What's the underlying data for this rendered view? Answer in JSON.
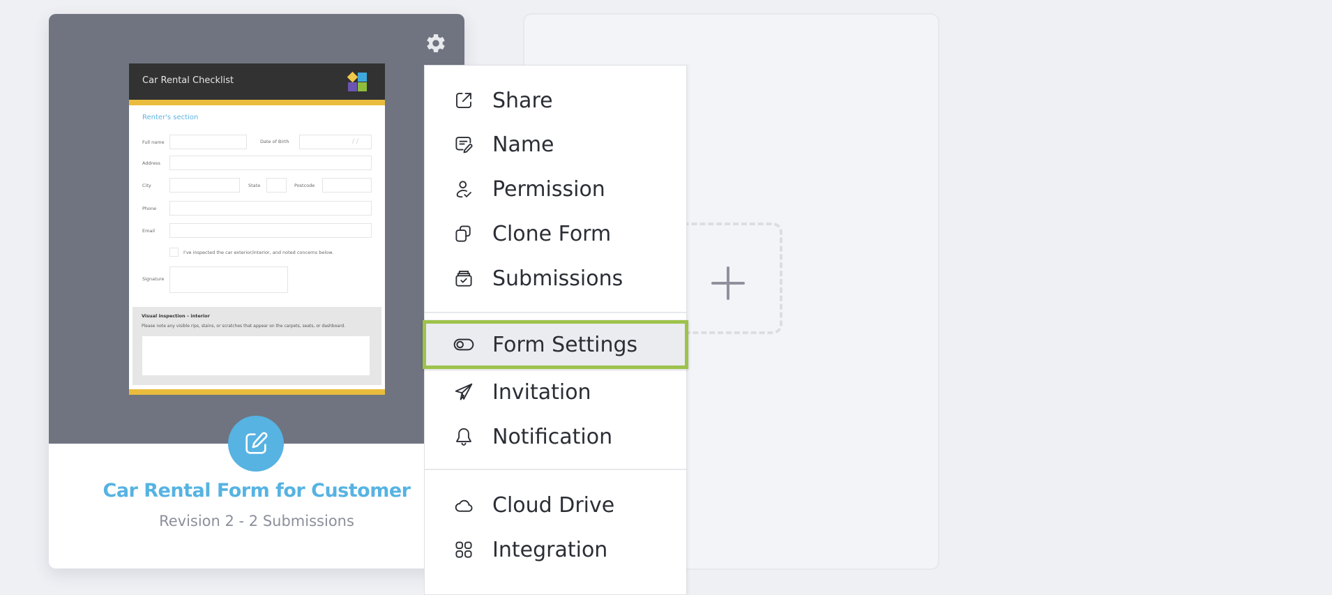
{
  "form_card": {
    "title": "Car Rental Form for Customer",
    "subtitle": "Revision 2 - 2 Submissions",
    "accent_color": "#56b3e2",
    "preview": {
      "header_title": "Car Rental Checklist",
      "section_title": "Renter's section",
      "fields": {
        "full_name": "Full name",
        "date_of_birth": "Date of Birth",
        "date_sep": "/      /",
        "address": "Address",
        "city": "City",
        "state": "State",
        "postcode": "Postcode",
        "phone": "Phone",
        "email": "Email",
        "signature": "Signature"
      },
      "checkbox_text": "I've inspected the car exterior/interior, and noted concerns below.",
      "inspection_title": "Visual inspection – interior",
      "inspection_desc": "Please note any visible rips, stains, or scratches that appear on the carpets, seats, or dashboard."
    }
  },
  "menu": {
    "items": [
      {
        "label": "Share",
        "icon": "share-icon"
      },
      {
        "label": "Name",
        "icon": "rename-icon"
      },
      {
        "label": "Permission",
        "icon": "user-check-icon"
      },
      {
        "label": "Clone Form",
        "icon": "clone-icon"
      },
      {
        "label": "Submissions",
        "icon": "inbox-check-icon"
      },
      {
        "label": "Form Settings",
        "icon": "toggle-icon",
        "highlighted": true
      },
      {
        "label": "Invitation",
        "icon": "paper-plane-icon"
      },
      {
        "label": "Notification",
        "icon": "bell-icon"
      },
      {
        "label": "Cloud Drive",
        "icon": "cloud-icon"
      },
      {
        "label": "Integration",
        "icon": "grid-icon"
      }
    ],
    "highlight_color": "#9dc24b"
  },
  "add_card": {
    "icon": "plus-icon"
  }
}
